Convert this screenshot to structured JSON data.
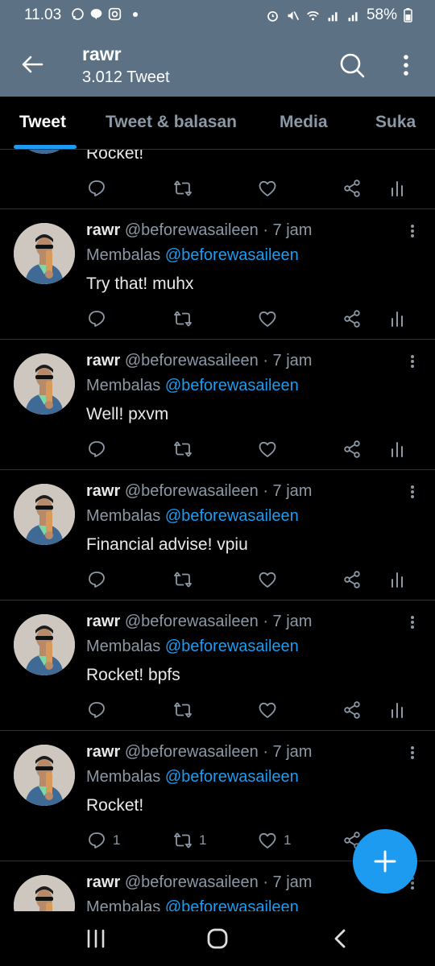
{
  "status": {
    "time": "11.03",
    "battery": "58%"
  },
  "header": {
    "title": "rawr",
    "subtitle": "3.012 Tweet"
  },
  "tabs": [
    {
      "label": "Tweet",
      "active": true
    },
    {
      "label": "Tweet & balasan",
      "active": false
    },
    {
      "label": "Media",
      "active": false
    },
    {
      "label": "Suka",
      "active": false
    }
  ],
  "tweets": [
    {
      "name": "rawr",
      "handle": "@beforewasaileen",
      "time": "· 7 jam",
      "reply_prefix": "Membalas",
      "reply_to": "@beforewasaileen",
      "text": "Rocket!",
      "replies": "",
      "retweets": "",
      "likes": ""
    },
    {
      "name": "rawr",
      "handle": "@beforewasaileen",
      "time": "· 7 jam",
      "reply_prefix": "Membalas",
      "reply_to": "@beforewasaileen",
      "text": "Try that! muhx",
      "replies": "",
      "retweets": "",
      "likes": ""
    },
    {
      "name": "rawr",
      "handle": "@beforewasaileen",
      "time": "· 7 jam",
      "reply_prefix": "Membalas",
      "reply_to": "@beforewasaileen",
      "text": "Well! pxvm",
      "replies": "",
      "retweets": "",
      "likes": ""
    },
    {
      "name": "rawr",
      "handle": "@beforewasaileen",
      "time": "· 7 jam",
      "reply_prefix": "Membalas",
      "reply_to": "@beforewasaileen",
      "text": "Financial advise! vpiu",
      "replies": "",
      "retweets": "",
      "likes": ""
    },
    {
      "name": "rawr",
      "handle": "@beforewasaileen",
      "time": "· 7 jam",
      "reply_prefix": "Membalas",
      "reply_to": "@beforewasaileen",
      "text": "Rocket! bpfs",
      "replies": "",
      "retweets": "",
      "likes": ""
    },
    {
      "name": "rawr",
      "handle": "@beforewasaileen",
      "time": "· 7 jam",
      "reply_prefix": "Membalas",
      "reply_to": "@beforewasaileen",
      "text": "Rocket!",
      "replies": "1",
      "retweets": "1",
      "likes": "1"
    },
    {
      "name": "rawr",
      "handle": "@beforewasaileen",
      "time": "· 7 jam",
      "reply_prefix": "Membalas",
      "reply_to": "@beforewasaileen",
      "text": "",
      "replies": "",
      "retweets": "",
      "likes": ""
    }
  ],
  "colors": {
    "header_bg": "#5d7185",
    "accent": "#1d9bf0",
    "background": "#000000",
    "muted": "#8b98a5"
  },
  "icons": [
    "back-arrow-icon",
    "search-icon",
    "more-vertical-icon",
    "reply-icon",
    "retweet-icon",
    "like-icon",
    "share-icon",
    "views-icon",
    "compose-plus-icon",
    "recents-icon",
    "home-icon",
    "back-icon"
  ]
}
